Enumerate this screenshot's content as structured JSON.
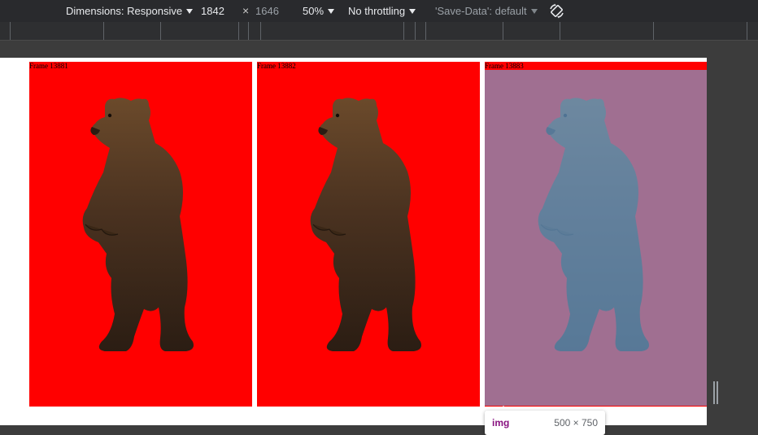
{
  "toolbar": {
    "dimensions_label": "Dimensions: Responsive",
    "width": "1842",
    "times": "×",
    "height": "1646",
    "zoom": "50%",
    "throttling": "No throttling",
    "save_data": "'Save-Data': default",
    "rotate_icon": "rotate-icon"
  },
  "frames": [
    {
      "label": "Frame 13881",
      "highlighted": false
    },
    {
      "label": "Frame 13882",
      "highlighted": false
    },
    {
      "label": "Frame 13883",
      "highlighted": true
    }
  ],
  "tooltip": {
    "tag": "img",
    "size": "500 × 750"
  },
  "colors": {
    "frame_background": "#ff0000",
    "highlight_overlay": "#6fa8dc",
    "toolbar_background": "#292a2d",
    "tooltip_tag": "#881280"
  }
}
